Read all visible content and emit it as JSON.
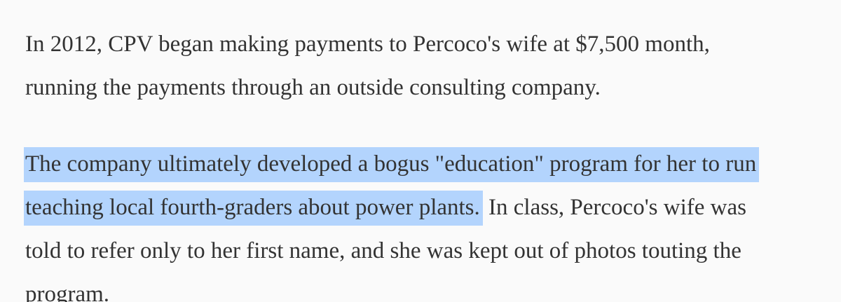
{
  "article": {
    "paragraph_1": {
      "line_1": "In 2012, CPV began making payments to Percoco's wife at $7,500 month,",
      "line_2": "running the payments through an outside consulting company."
    },
    "paragraph_2": {
      "highlighted_line_1": "The company ultimately developed a bogus \"education\" program for her to run",
      "highlighted_line_2": "teaching local fourth-graders about power plants.",
      "line_2_rest": " In class, Percoco's wife was",
      "line_3": "told to refer only to her first name, and she was kept out of photos touting the",
      "line_4": "program."
    },
    "highlight_color": "#b3d4fd",
    "text_color": "#333333",
    "background_color": "#fafafa"
  }
}
